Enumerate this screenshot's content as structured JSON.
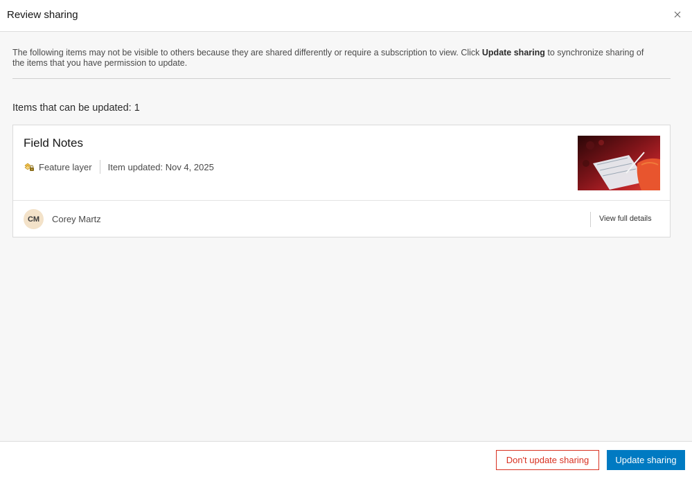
{
  "dialog": {
    "title": "Review sharing",
    "close_icon": "close-icon"
  },
  "notice": {
    "text_before": "The following items may not be visible to others because they are shared differently or require a subscription to view. Click ",
    "bold": "Update sharing",
    "text_after": " to synchronize sharing of the items that you have permission to update."
  },
  "items_section": {
    "heading": "Items that can be updated: 1"
  },
  "item": {
    "name": "Field Notes",
    "type_icon": "feature-layer-icon",
    "type": "Feature layer",
    "updated": "Item updated: Nov 4, 2025",
    "thumbnail": "thumbnail-image",
    "owner_initials": "CM",
    "owner_name": "Corey Martz",
    "details_link": "View full details"
  },
  "footer": {
    "secondary_label": "Don't update sharing",
    "primary_label": "Update sharing"
  },
  "colors": {
    "primary": "#007ac2",
    "danger": "#d83020",
    "avatar_bg": "#f3e2c9"
  }
}
